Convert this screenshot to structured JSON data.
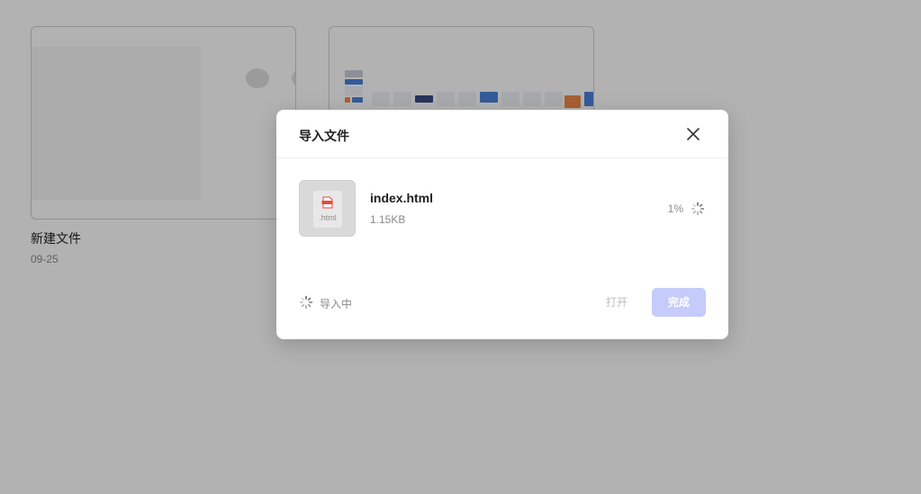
{
  "files": [
    {
      "name": "新建文件",
      "date": "09-25"
    },
    {
      "name": "",
      "date": ""
    }
  ],
  "dialog": {
    "title": "导入文件",
    "close_icon": "close-icon",
    "file": {
      "name": "index.html",
      "size": "1.15KB",
      "extension": ".html",
      "badge_text": "HTML",
      "progress_text": "1%",
      "progress": 0.01
    },
    "status_text": "导入中",
    "open_label": "打开",
    "done_label": "完成"
  },
  "colors": {
    "overlay": "rgba(0,0,0,0.30)",
    "primary_disabled": "#c5cbfa",
    "html_badge": "#e54a3a",
    "text_muted": "#8a8a8a"
  }
}
